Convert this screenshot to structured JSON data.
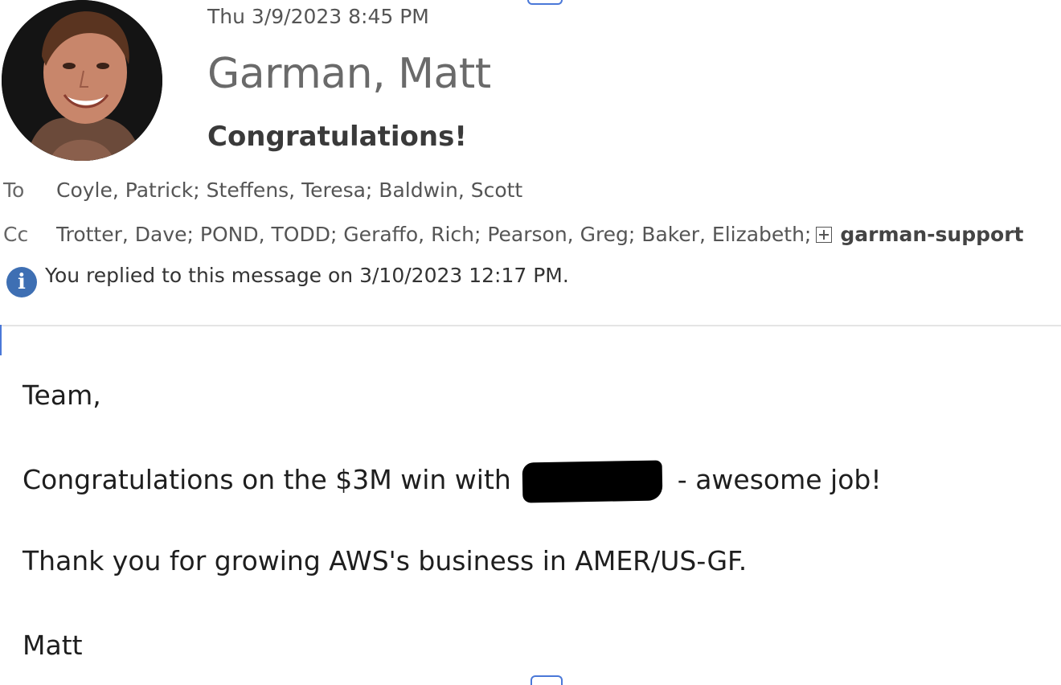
{
  "message": {
    "datetime": "Thu 3/9/2023 8:45 PM",
    "sender": "Garman, Matt",
    "subject": "Congratulations!"
  },
  "recipients": {
    "to_label": "To",
    "to": "Coyle, Patrick; Steffens, Teresa; Baldwin, Scott",
    "cc_label": "Cc",
    "cc": "Trotter, Dave; POND, TODD; Geraffo, Rich; Pearson, Greg; Baker, Elizabeth;",
    "cc_group": "garman-support"
  },
  "info_bar": {
    "text": "You replied to this message on 3/10/2023 12:17 PM."
  },
  "body": {
    "greeting": "Team,",
    "line1_before": "Congratulations on the $3M win with",
    "line1_after": "- awesome job!",
    "line2": "Thank you for growing AWS's business in AMER/US-GF.",
    "signoff": "Matt"
  },
  "colors": {
    "info_icon": "#3e6fb3",
    "sender_text": "#6a6a6a",
    "redaction": "#000000"
  },
  "icons": {
    "avatar": "sender-photo",
    "info": "info-icon",
    "expand": "expand-group-icon"
  }
}
